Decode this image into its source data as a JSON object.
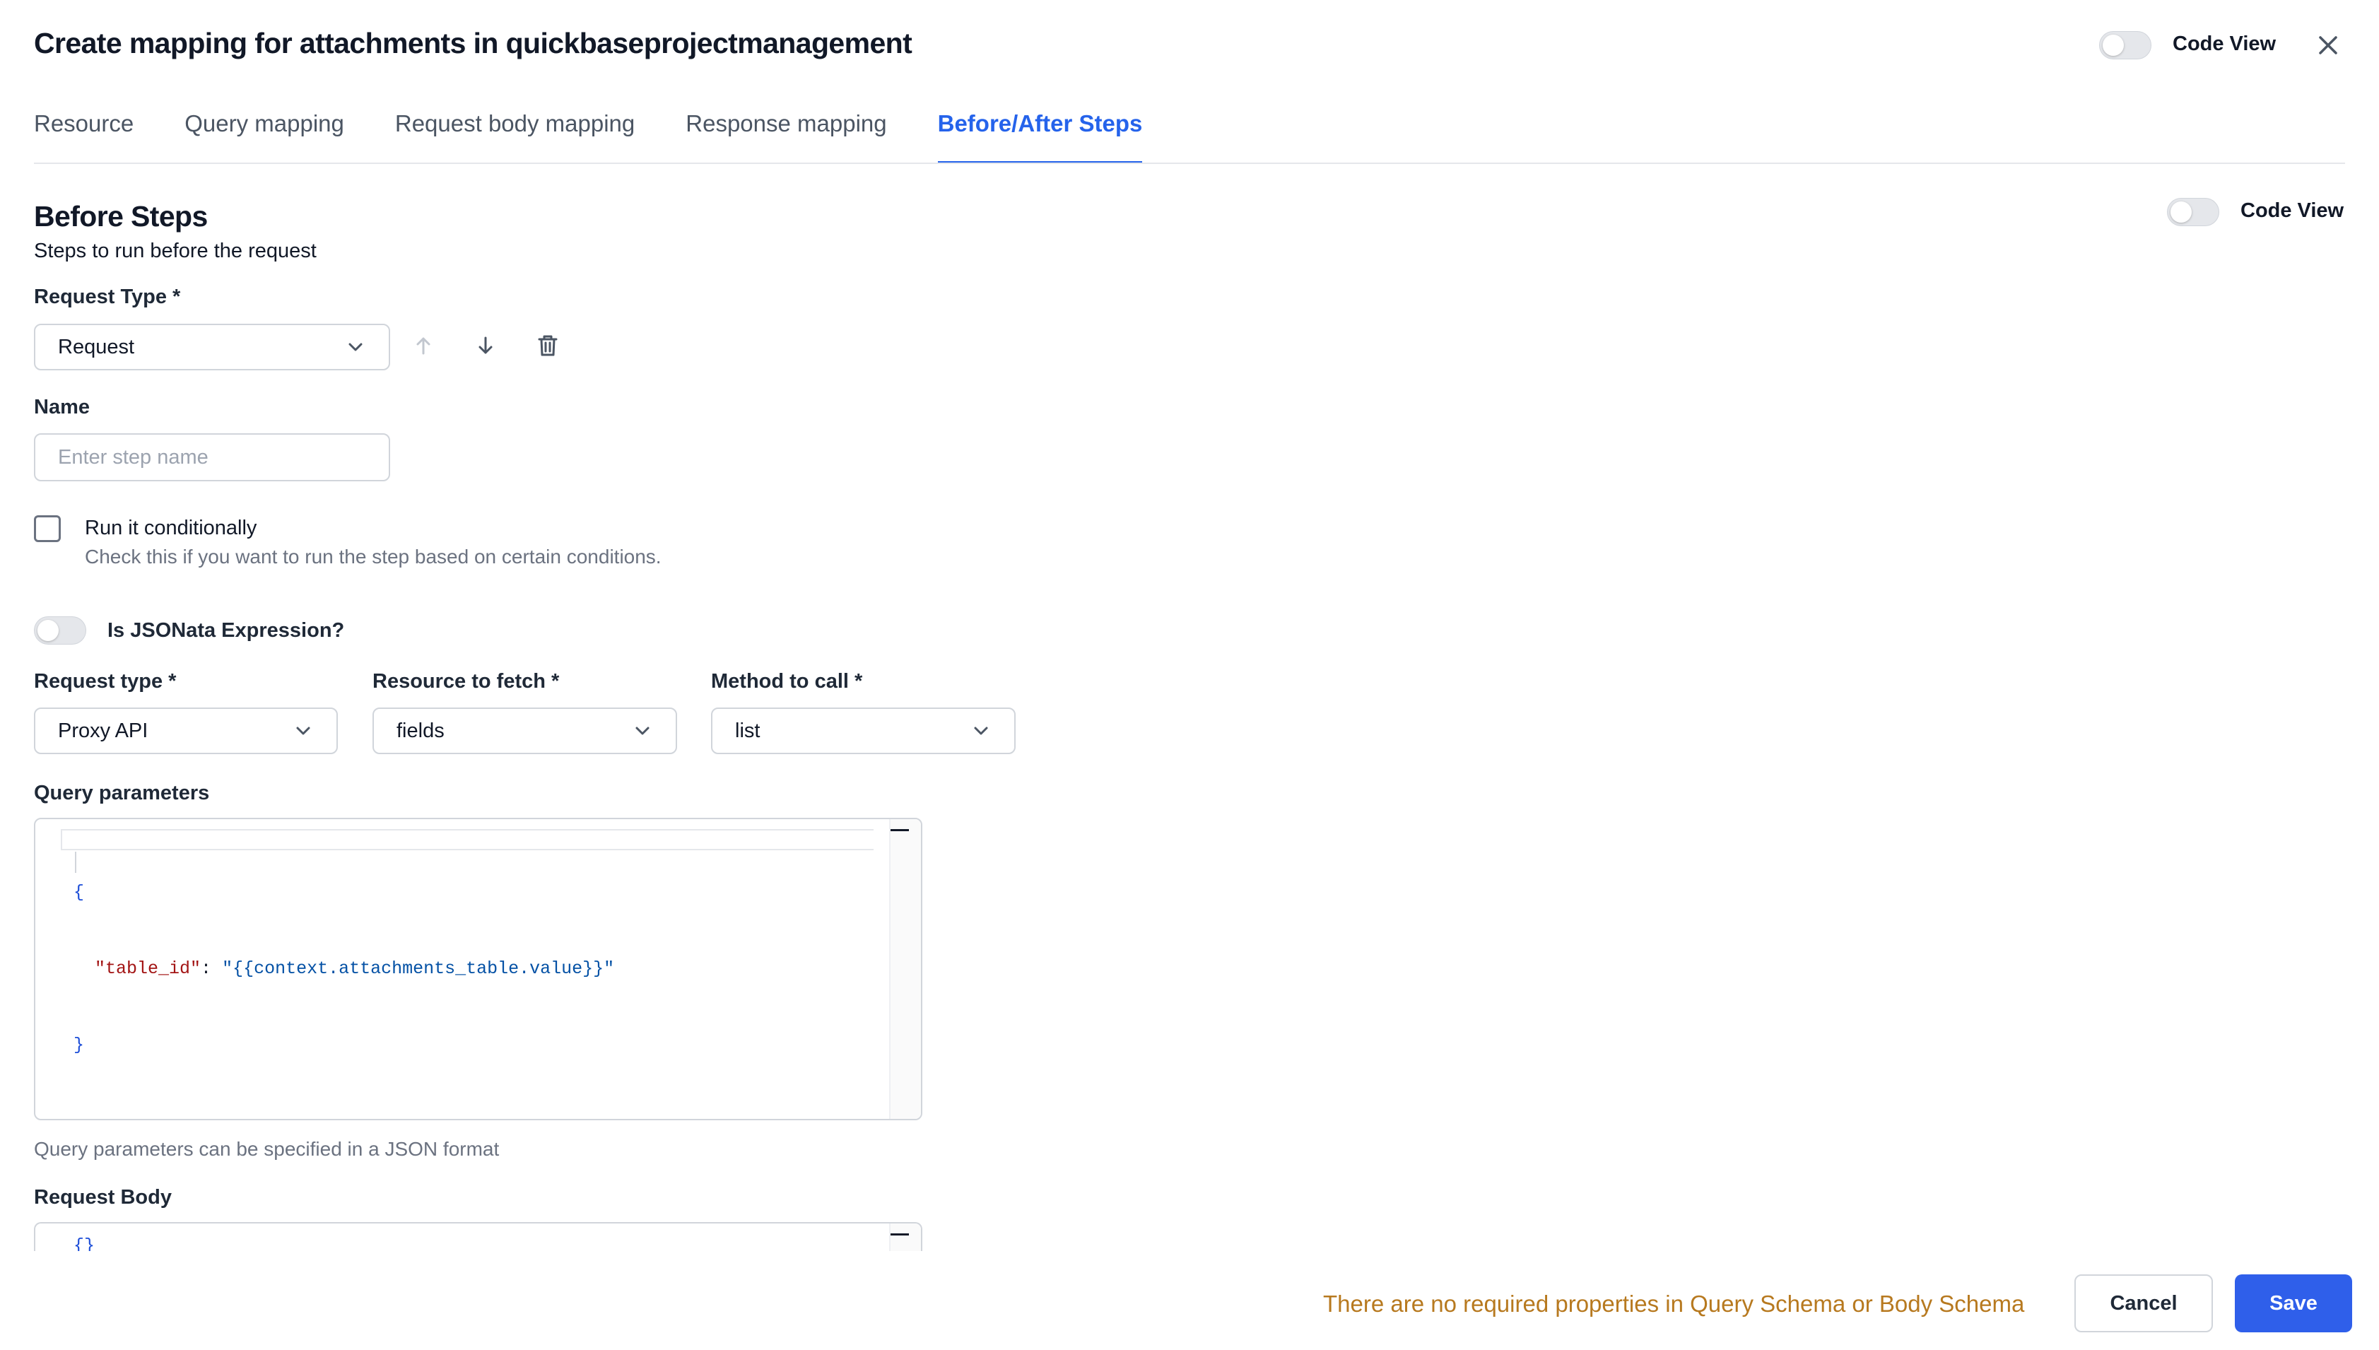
{
  "modal": {
    "title": "Create mapping for attachments in quickbaseprojectmanagement",
    "code_view_label": "Code View"
  },
  "tabs": [
    {
      "label": "Resource",
      "active": false
    },
    {
      "label": "Query mapping",
      "active": false
    },
    {
      "label": "Request body mapping",
      "active": false
    },
    {
      "label": "Response mapping",
      "active": false
    },
    {
      "label": "Before/After Steps",
      "active": true
    }
  ],
  "before_steps": {
    "title": "Before Steps",
    "subtitle": "Steps to run before the request",
    "code_view_label": "Code View",
    "request_type_label": "Request Type *",
    "request_type_value": "Request",
    "name_label": "Name",
    "name_value": "",
    "name_placeholder": "Enter step name",
    "run_conditionally": {
      "label": "Run it conditionally",
      "help": "Check this if you want to run the step based on certain conditions.",
      "checked": false
    },
    "jsonata_label": "Is JSONata Expression?",
    "jsonata_enabled": false,
    "request_type2": {
      "label": "Request type *",
      "value": "Proxy API"
    },
    "resource_to_fetch": {
      "label": "Resource to fetch *",
      "value": "fields"
    },
    "method_to_call": {
      "label": "Method to call *",
      "value": "list"
    },
    "query_parameters": {
      "label": "Query parameters",
      "open_brace": "{",
      "key": "\"table_id\"",
      "colon": ": ",
      "value": "\"{{context.attachments_table.value}}\"",
      "close_brace": "}",
      "helper": "Query parameters can be specified in a JSON format"
    },
    "request_body": {
      "label": "Request Body",
      "code": "{}"
    }
  },
  "footer": {
    "message": "There are no required properties in Query Schema or Body Schema",
    "cancel_label": "Cancel",
    "save_label": "Save"
  },
  "icons": {
    "close": "close-icon",
    "chevron": "chevron-down-icon",
    "move_up": "arrow-up-icon",
    "move_down": "arrow-down-icon",
    "delete": "trash-icon"
  },
  "colors": {
    "accent": "#2563eb",
    "save_button": "#2f5fea",
    "warning_text": "#b7791f"
  }
}
